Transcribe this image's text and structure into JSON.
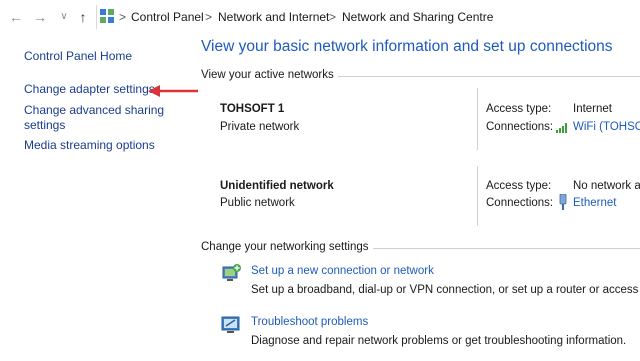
{
  "address_bar": {
    "crumbs": [
      "Control Panel",
      "Network and Internet",
      "Network and Sharing Centre"
    ],
    "separator": ">"
  },
  "left_pane": {
    "home": "Control Panel Home",
    "links": [
      "Change adapter settings",
      "Change advanced sharing settings",
      "Media streaming options"
    ]
  },
  "main": {
    "title": "View your basic network information and set up connections",
    "active_label": "View your active networks",
    "networks": [
      {
        "name": "TOHSOFT 1",
        "type": "Private network",
        "access_label": "Access type:",
        "access_value": "Internet",
        "conn_label": "Connections:",
        "conn_value": "WiFi (TOHSOF"
      },
      {
        "name": "Unidentified network",
        "type": "Public network",
        "access_label": "Access type:",
        "access_value": "No network ac",
        "conn_label": "Connections:",
        "conn_value": "Ethernet"
      }
    ],
    "settings_label": "Change your networking settings",
    "tasks": [
      {
        "title": "Set up a new connection or network",
        "desc": "Set up a broadband, dial-up or VPN connection, or set up a router or access point"
      },
      {
        "title": "Troubleshoot problems",
        "desc": "Diagnose and repair network problems or get troubleshooting information."
      }
    ]
  },
  "colors": {
    "link": "#1e5bbd",
    "arrow": "#d6343a"
  }
}
